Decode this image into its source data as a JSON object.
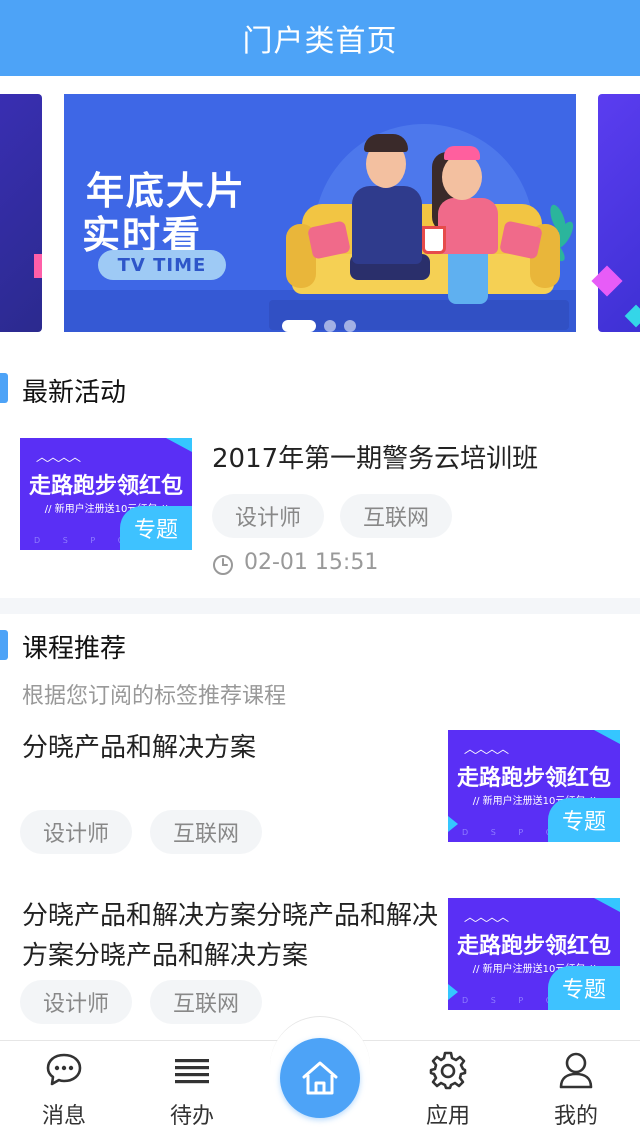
{
  "header": {
    "title": "门户类首页"
  },
  "banner": {
    "line1": "年底大片",
    "line2": "实时看",
    "pill": "TV TIME",
    "slide_count": 3,
    "active_slide": 1
  },
  "latest": {
    "title": "最新活动",
    "item": {
      "thumb": {
        "headline": "走路跑步领红包",
        "subline": "// 新用户注册送10元红包 //",
        "dots": "D S P C R",
        "badge": "专题"
      },
      "title": "2017年第一期警务云培训班",
      "tags": [
        "设计师",
        "互联网"
      ],
      "time": "02-01 15:51"
    }
  },
  "courses": {
    "title": "课程推荐",
    "subtitle": "根据您订阅的标签推荐课程",
    "items": [
      {
        "title": "分晓产品和解决方案",
        "tags": [
          "设计师",
          "互联网"
        ],
        "thumb": {
          "headline": "走路跑步领红包",
          "subline": "// 新用户注册送10元红包 //",
          "dots": "D S P C R",
          "badge": "专题"
        }
      },
      {
        "title": "分晓产品和解决方案分晓产品和解决方案分晓产品和解决方案",
        "tags": [
          "设计师",
          "互联网"
        ],
        "thumb": {
          "headline": "走路跑步领红包",
          "subline": "// 新用户注册送10元红包 //",
          "dots": "D S P C R",
          "badge": "专题"
        }
      }
    ]
  },
  "nav": {
    "items": [
      {
        "label": "消息",
        "icon": "message-icon"
      },
      {
        "label": "待办",
        "icon": "list-icon"
      },
      {
        "label": "",
        "icon": "home-icon"
      },
      {
        "label": "应用",
        "icon": "gear-icon"
      },
      {
        "label": "我的",
        "icon": "user-icon"
      }
    ]
  },
  "colors": {
    "primary": "#4da3f7",
    "thumb": "#5a2ff5",
    "badge": "#3ec2ff",
    "tag_bg": "#f3f5f7"
  }
}
